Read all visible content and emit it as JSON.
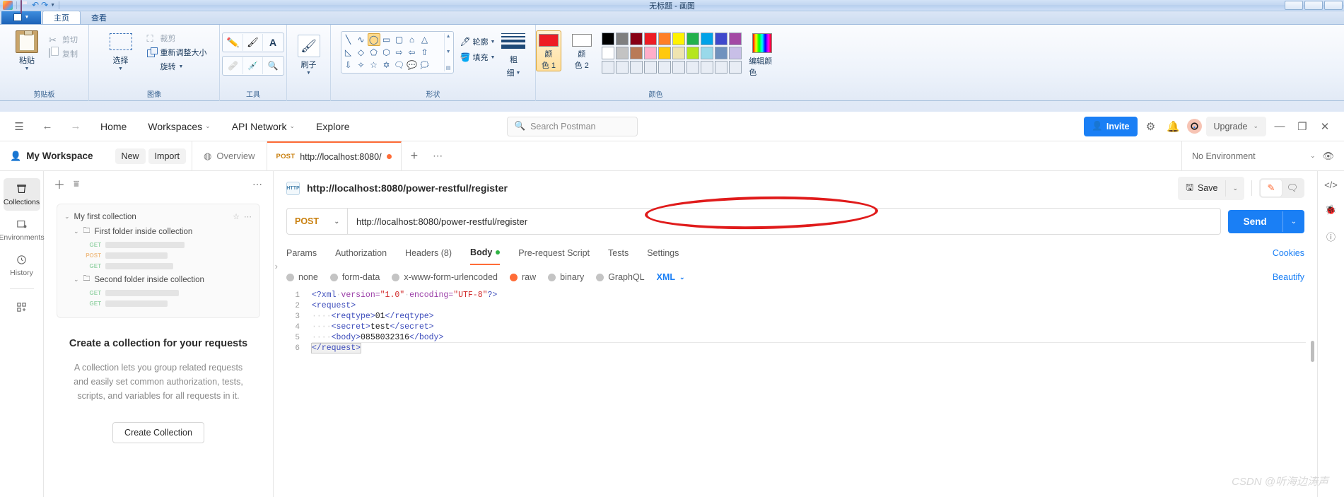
{
  "paint": {
    "title": "无标题 - 画图",
    "quick_access": [
      "save-icon",
      "undo-icon",
      "redo-icon",
      "customize-caret"
    ],
    "tabs": [
      {
        "label": "主页",
        "active": true
      },
      {
        "label": "查看",
        "active": false
      }
    ],
    "groups": [
      {
        "label": "剪贴板",
        "paste": "粘贴",
        "cut": "剪切",
        "copy": "复制"
      },
      {
        "label": "图像",
        "select": "选择",
        "crop": "裁剪",
        "resize": "重新调整大小",
        "rotate": "旋转"
      },
      {
        "label": "工具",
        "tools": [
          "pencil-icon",
          "fill-icon",
          "text-icon",
          "eraser-icon",
          "color-picker-icon",
          "magnifier-icon"
        ]
      },
      {
        "label": "刷子",
        "brush": "刷子"
      },
      {
        "label": "形状",
        "outline": "轮廓",
        "fill": "填充",
        "shapes_row1": [
          "line",
          "curve",
          "ellipse",
          "rectangle",
          "rounded-rect",
          "polygon",
          "triangle"
        ],
        "shapes_row2": [
          "right-triangle",
          "diamond",
          "pentagon",
          "hexagon",
          "right-arrow",
          "left-arrow",
          "up-arrow"
        ],
        "shapes_row3": [
          "down-arrow",
          "four-point-star",
          "five-point-star",
          "six-point-star",
          "callout-rect",
          "callout-round",
          "callout-cloud"
        ],
        "selected_shape": "ellipse",
        "size": "粗\n细",
        "size_label_1": "粗",
        "size_label_2": "细"
      },
      {
        "label": "颜色",
        "color1_label_a": "颜",
        "color1_label_b": "色 1",
        "color2_label_a": "颜",
        "color2_label_b": "色 2",
        "color1": "#ED1C24",
        "color2": "#FFFFFF",
        "edit_colors": "编辑颜色",
        "palette_row1": [
          "#000000",
          "#7F7F7F",
          "#880015",
          "#ED1C24",
          "#FF7F27",
          "#FFF200",
          "#22B14C",
          "#00A2E8",
          "#3F48CC",
          "#A349A4"
        ],
        "palette_row2": [
          "#FFFFFF",
          "#C3C3C3",
          "#B97A57",
          "#FFAEC9",
          "#FFC90E",
          "#EFE4B0",
          "#B5E61D",
          "#99D9EA",
          "#7092BE",
          "#C8BFE7"
        ],
        "palette_row3": [
          "#E8EDF5",
          "#E8EDF5",
          "#E8EDF5",
          "#E8EDF5",
          "#E8EDF5",
          "#E8EDF5",
          "#E8EDF5",
          "#E8EDF5",
          "#E8EDF5",
          "#E8EDF5"
        ]
      }
    ]
  },
  "postman": {
    "header": {
      "menu_icon": "hamburger-icon",
      "back_icon": "arrow-left-icon",
      "forward_icon": "arrow-right-icon",
      "nav": [
        {
          "label": "Home",
          "caret": false
        },
        {
          "label": "Workspaces",
          "caret": true
        },
        {
          "label": "API Network",
          "caret": true
        },
        {
          "label": "Explore",
          "caret": false
        }
      ],
      "search_placeholder": "Search Postman",
      "invite_label": "Invite",
      "settings_icon": "gear-icon",
      "notifications_icon": "bell-icon",
      "avatar_icon": "user-avatar",
      "upgrade_label": "Upgrade",
      "minimize_icon": "minimize-icon",
      "maximize_icon": "maximize-icon",
      "close_icon": "close-icon"
    },
    "workspace_bar": {
      "workspace_name": "My Workspace",
      "new_label": "New",
      "import_label": "Import",
      "overview_tab": "Overview",
      "request_tab": {
        "method": "POST",
        "label": "http://localhost:8080/",
        "unsaved": true
      },
      "plus_icon": "plus-icon",
      "more_icon": "more-options-icon",
      "environment_label": "No Environment"
    },
    "rail": [
      {
        "label": "Collections",
        "icon": "collections-icon",
        "active": true
      },
      {
        "label": "Environments",
        "icon": "environments-icon",
        "active": false
      },
      {
        "label": "History",
        "icon": "history-icon",
        "active": false
      },
      {
        "label": "",
        "icon": "add-apps-icon",
        "active": false
      }
    ],
    "sidebar": {
      "plus_icon": "plus-icon",
      "filter_icon": "filter-icon",
      "more_icon": "more-options-icon",
      "ghost_collection": {
        "name": "My first collection",
        "folders": [
          {
            "name": "First folder inside collection",
            "requests": [
              "GET",
              "POST",
              "GET"
            ]
          },
          {
            "name": "Second folder inside collection",
            "requests": [
              "GET",
              "GET"
            ]
          }
        ]
      },
      "empty_title": "Create a collection for your requests",
      "empty_desc": "A collection lets you group related requests and easily set common authorization, tests, scripts, and variables for all requests in it.",
      "create_button": "Create Collection"
    },
    "request": {
      "title": "http://localhost:8080/power-restful/register",
      "http_badge": "HTTP",
      "save_label": "Save",
      "edit_icon": "pencil-icon",
      "comment_icon": "comment-icon",
      "method": "POST",
      "url": "http://localhost:8080/power-restful/register",
      "send_label": "Send",
      "tabs": [
        {
          "label": "Params",
          "active": false,
          "badge": ""
        },
        {
          "label": "Authorization",
          "active": false,
          "badge": ""
        },
        {
          "label": "Headers (8)",
          "active": false,
          "badge": ""
        },
        {
          "label": "Body",
          "active": true,
          "badge": "dot"
        },
        {
          "label": "Pre-request Script",
          "active": false,
          "badge": ""
        },
        {
          "label": "Tests",
          "active": false,
          "badge": ""
        },
        {
          "label": "Settings",
          "active": false,
          "badge": ""
        }
      ],
      "cookies_label": "Cookies",
      "body_options": [
        {
          "label": "none",
          "selected": false
        },
        {
          "label": "form-data",
          "selected": false
        },
        {
          "label": "x-www-form-urlencoded",
          "selected": false
        },
        {
          "label": "raw",
          "selected": true
        },
        {
          "label": "binary",
          "selected": false
        },
        {
          "label": "GraphQL",
          "selected": false
        }
      ],
      "format": "XML",
      "beautify_label": "Beautify",
      "code": [
        {
          "n": "1",
          "parts": [
            {
              "t": "<?xml",
              "c": "ctag"
            },
            {
              "t": "·",
              "c": "cdot"
            },
            {
              "t": "version=",
              "c": "cattr"
            },
            {
              "t": "\"1.0\"",
              "c": "cval"
            },
            {
              "t": "·",
              "c": "cdot"
            },
            {
              "t": "encoding=",
              "c": "cattr"
            },
            {
              "t": "\"UTF-8\"",
              "c": "cval"
            },
            {
              "t": "?>",
              "c": "ctag"
            }
          ]
        },
        {
          "n": "2",
          "parts": [
            {
              "t": "<request>",
              "c": "ctag"
            }
          ]
        },
        {
          "n": "3",
          "parts": [
            {
              "t": "····",
              "c": "cdot"
            },
            {
              "t": "<reqtype>",
              "c": "ctag"
            },
            {
              "t": "01",
              "c": "ctxt"
            },
            {
              "t": "</reqtype>",
              "c": "ctag"
            }
          ]
        },
        {
          "n": "4",
          "parts": [
            {
              "t": "····",
              "c": "cdot"
            },
            {
              "t": "<secret>",
              "c": "ctag"
            },
            {
              "t": "test",
              "c": "ctxt"
            },
            {
              "t": "</secret>",
              "c": "ctag"
            }
          ]
        },
        {
          "n": "5",
          "parts": [
            {
              "t": "····",
              "c": "cdot"
            },
            {
              "t": "<body>",
              "c": "ctag"
            },
            {
              "t": "0858032316",
              "c": "ctxt"
            },
            {
              "t": "</body>",
              "c": "ctag"
            }
          ]
        },
        {
          "n": "6",
          "parts": [
            {
              "t": "</request>",
              "c": "ctag cursor-box"
            }
          ]
        }
      ]
    },
    "far_rail": [
      "code-icon",
      "debug-icon",
      "info-icon"
    ]
  },
  "watermark": "CSDN @听海边涛声",
  "annotation": {
    "shape": "red-ellipse",
    "target": "url-input"
  },
  "colors": {
    "accent": "#ff6c37",
    "blue": "#1a7ff5",
    "annotation_red": "#e01b1b",
    "paint_red": "#ED1C24"
  }
}
